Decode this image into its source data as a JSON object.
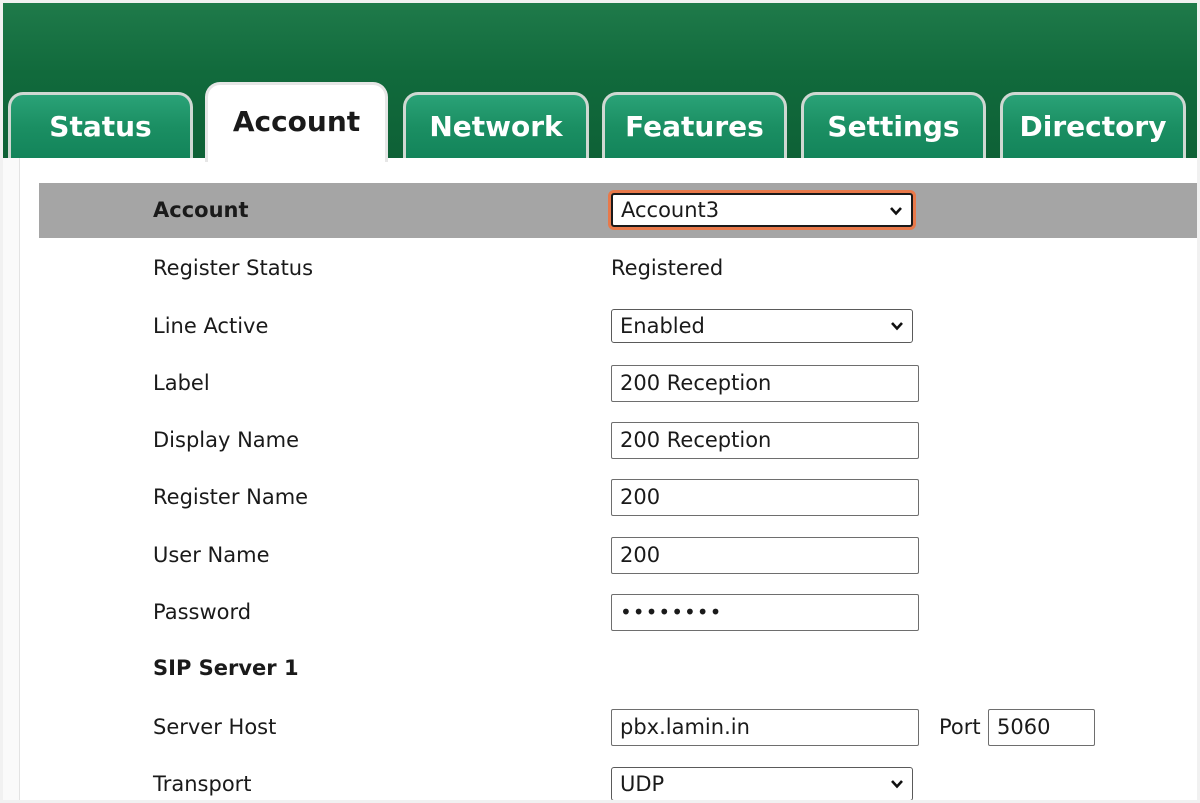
{
  "tabs": [
    {
      "label": "Status",
      "active": false
    },
    {
      "label": "Account",
      "active": true
    },
    {
      "label": "Network",
      "active": false
    },
    {
      "label": "Features",
      "active": false
    },
    {
      "label": "Settings",
      "active": false
    },
    {
      "label": "Directory",
      "active": false
    }
  ],
  "account_bar": {
    "label": "Account",
    "selected": "Account3"
  },
  "fields": {
    "register_status": {
      "label": "Register Status",
      "value": "Registered"
    },
    "line_active": {
      "label": "Line Active",
      "value": "Enabled"
    },
    "label": {
      "label": "Label",
      "value": "200 Reception"
    },
    "display_name": {
      "label": "Display Name",
      "value": "200 Reception"
    },
    "register_name": {
      "label": "Register Name",
      "value": "200"
    },
    "user_name": {
      "label": "User Name",
      "value": "200"
    },
    "password": {
      "label": "Password",
      "value": "••••••••"
    }
  },
  "sip_server": {
    "heading": "SIP Server 1",
    "server_host": {
      "label": "Server Host",
      "value": "pbx.lamin.in"
    },
    "port": {
      "label": "Port",
      "value": "5060"
    },
    "transport": {
      "label": "Transport",
      "value": "UDP"
    }
  },
  "colors": {
    "header_green": "#116a3c",
    "tab_green": "#1b8f63",
    "title_bar_gray": "#a5a5a5",
    "focus_ring": "#e8794a"
  }
}
